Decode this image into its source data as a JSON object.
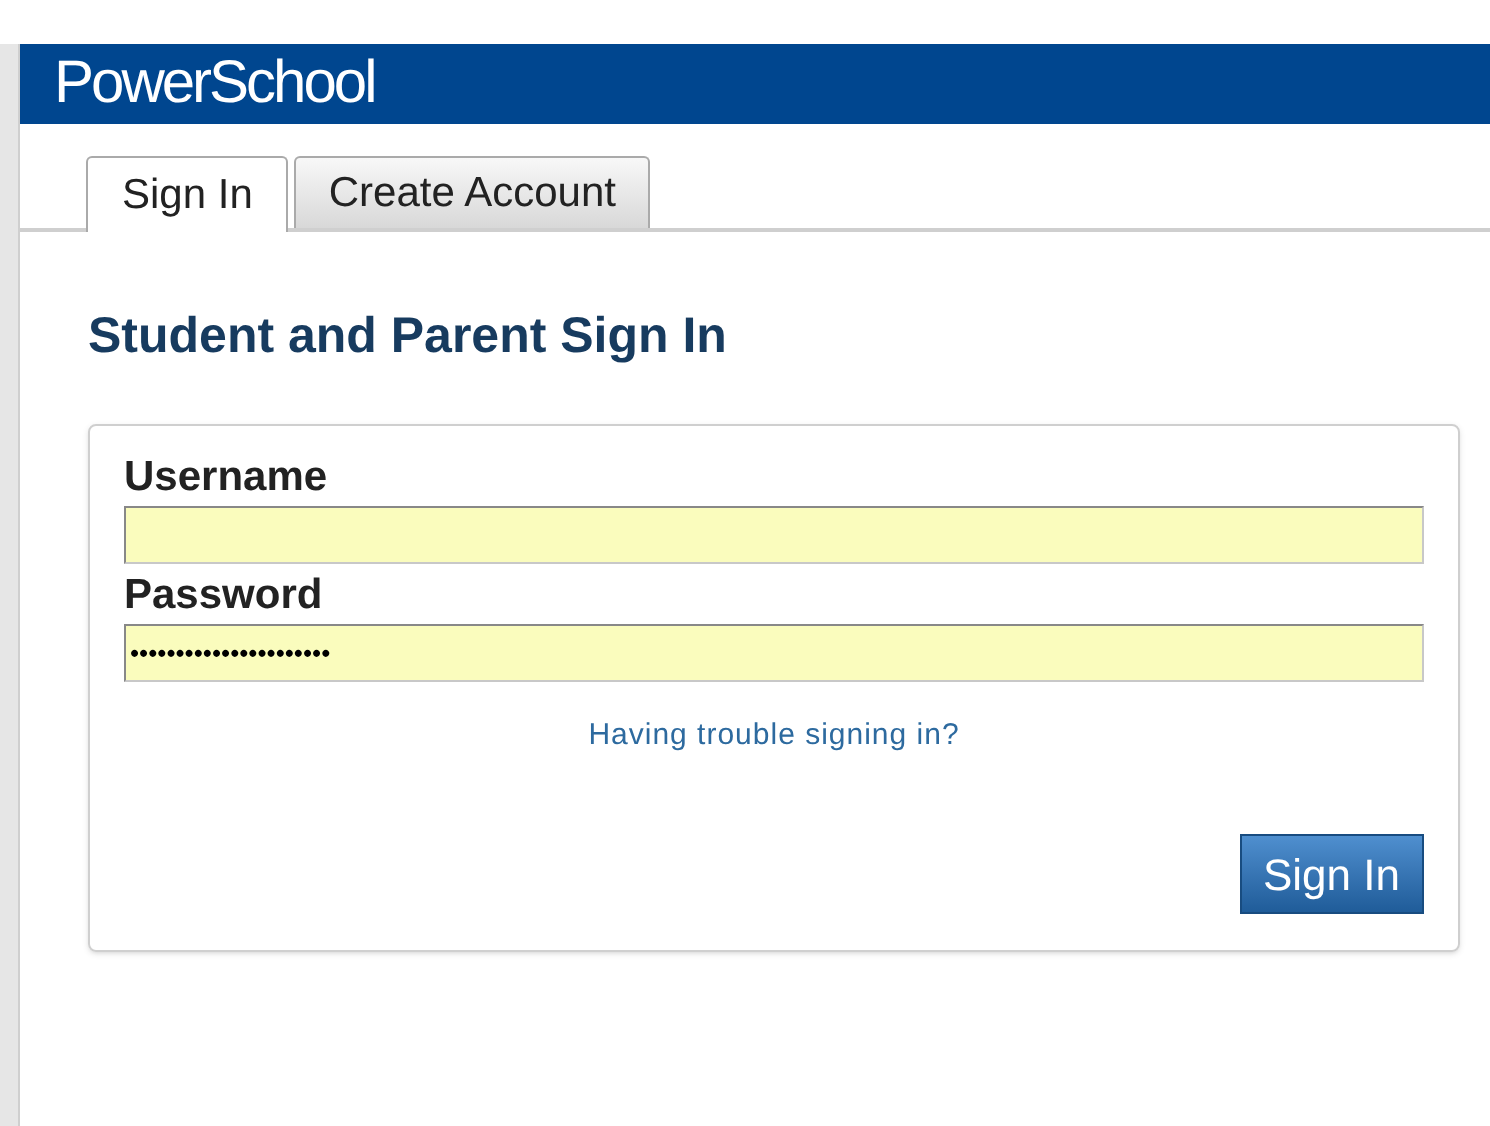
{
  "header": {
    "logo": "PowerSchool"
  },
  "tabs": [
    {
      "label": "Sign In",
      "selected": true
    },
    {
      "label": "Create Account",
      "selected": false
    }
  ],
  "heading": "Student and Parent Sign In",
  "fields": [
    {
      "label": "Username"
    },
    {
      "label": "Password",
      "value": "••••••••••••••••••••••"
    }
  ],
  "help_link": "Having trouble signing in?",
  "submit": "Sign In"
}
